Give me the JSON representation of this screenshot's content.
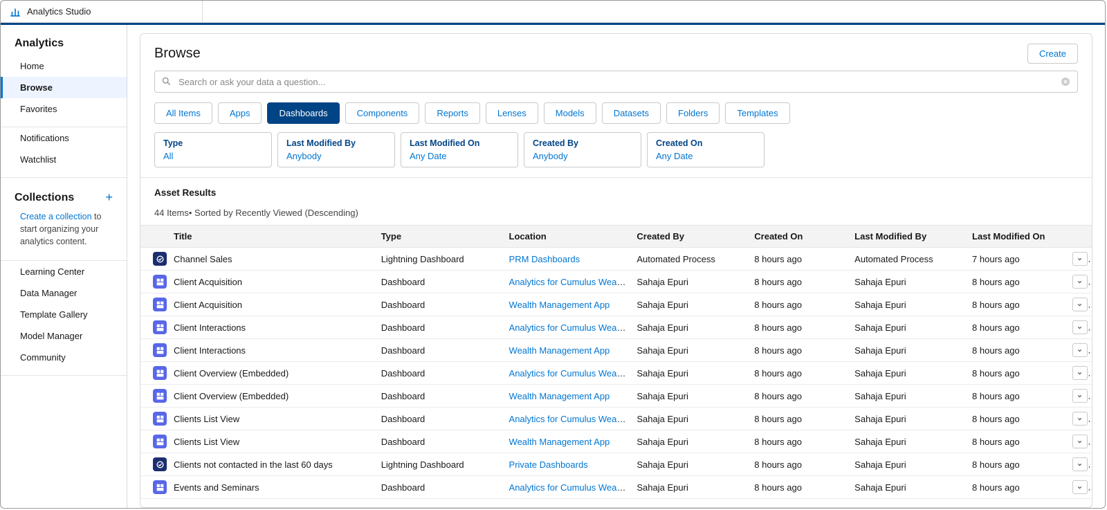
{
  "header": {
    "app_name": "Analytics Studio"
  },
  "sidebar": {
    "sections": [
      {
        "heading": "Analytics",
        "items": [
          "Home",
          "Browse",
          "Favorites"
        ],
        "active": "Browse"
      },
      {
        "items": [
          "Notifications",
          "Watchlist"
        ]
      },
      {
        "heading": "Collections",
        "plus": true,
        "desc_link": "Create a collection",
        "desc_rest": " to start organizing your analytics content."
      },
      {
        "items": [
          "Learning Center",
          "Data Manager",
          "Template Gallery",
          "Model Manager",
          "Community"
        ]
      }
    ]
  },
  "browse": {
    "title": "Browse",
    "create_label": "Create",
    "search_placeholder": "Search or ask your data a question...",
    "pills": [
      "All Items",
      "Apps",
      "Dashboards",
      "Components",
      "Reports",
      "Lenses",
      "Models",
      "Datasets",
      "Folders",
      "Templates"
    ],
    "active_pill": "Dashboards",
    "filters": [
      {
        "label": "Type",
        "value": "All"
      },
      {
        "label": "Last Modified By",
        "value": "Anybody"
      },
      {
        "label": "Last Modified On",
        "value": "Any Date"
      },
      {
        "label": "Created By",
        "value": "Anybody"
      },
      {
        "label": "Created On",
        "value": "Any Date"
      }
    ],
    "results_heading": "Asset Results",
    "results_sub": "44 Items• Sorted by Recently Viewed (Descending)",
    "columns": [
      "Title",
      "Type",
      "Location",
      "Created By",
      "Created On",
      "Last Modified By",
      "Last Modified On"
    ],
    "rows": [
      {
        "icon": "lt",
        "title": "Channel Sales",
        "type": "Lightning Dashboard",
        "location": "PRM Dashboards",
        "created_by": "Automated Process",
        "created_on": "8 hours ago",
        "last_mod_by": "Automated Process",
        "last_mod_on": "7 hours ago"
      },
      {
        "icon": "dash",
        "title": "Client Acquisition",
        "type": "Dashboard",
        "location": "Analytics for Cumulus Wealt...",
        "created_by": "Sahaja Epuri",
        "created_on": "8 hours ago",
        "last_mod_by": "Sahaja Epuri",
        "last_mod_on": "8 hours ago"
      },
      {
        "icon": "dash",
        "title": "Client Acquisition",
        "type": "Dashboard",
        "location": "Wealth Management App",
        "created_by": "Sahaja Epuri",
        "created_on": "8 hours ago",
        "last_mod_by": "Sahaja Epuri",
        "last_mod_on": "8 hours ago"
      },
      {
        "icon": "dash",
        "title": "Client Interactions",
        "type": "Dashboard",
        "location": "Analytics for Cumulus Wealt...",
        "created_by": "Sahaja Epuri",
        "created_on": "8 hours ago",
        "last_mod_by": "Sahaja Epuri",
        "last_mod_on": "8 hours ago"
      },
      {
        "icon": "dash",
        "title": "Client Interactions",
        "type": "Dashboard",
        "location": "Wealth Management App",
        "created_by": "Sahaja Epuri",
        "created_on": "8 hours ago",
        "last_mod_by": "Sahaja Epuri",
        "last_mod_on": "8 hours ago"
      },
      {
        "icon": "dash",
        "title": "Client Overview (Embedded)",
        "type": "Dashboard",
        "location": "Analytics for Cumulus Wealt...",
        "created_by": "Sahaja Epuri",
        "created_on": "8 hours ago",
        "last_mod_by": "Sahaja Epuri",
        "last_mod_on": "8 hours ago"
      },
      {
        "icon": "dash",
        "title": "Client Overview (Embedded)",
        "type": "Dashboard",
        "location": "Wealth Management App",
        "created_by": "Sahaja Epuri",
        "created_on": "8 hours ago",
        "last_mod_by": "Sahaja Epuri",
        "last_mod_on": "8 hours ago"
      },
      {
        "icon": "dash",
        "title": "Clients List View",
        "type": "Dashboard",
        "location": "Analytics for Cumulus Wealt...",
        "created_by": "Sahaja Epuri",
        "created_on": "8 hours ago",
        "last_mod_by": "Sahaja Epuri",
        "last_mod_on": "8 hours ago"
      },
      {
        "icon": "dash",
        "title": "Clients List View",
        "type": "Dashboard",
        "location": "Wealth Management App",
        "created_by": "Sahaja Epuri",
        "created_on": "8 hours ago",
        "last_mod_by": "Sahaja Epuri",
        "last_mod_on": "8 hours ago"
      },
      {
        "icon": "lt",
        "title": "Clients not contacted in the last 60 days",
        "type": "Lightning Dashboard",
        "location": "Private Dashboards",
        "created_by": "Sahaja Epuri",
        "created_on": "8 hours ago",
        "last_mod_by": "Sahaja Epuri",
        "last_mod_on": "8 hours ago"
      },
      {
        "icon": "dash",
        "title": "Events and Seminars",
        "type": "Dashboard",
        "location": "Analytics for Cumulus Wealt...",
        "created_by": "Sahaja Epuri",
        "created_on": "8 hours ago",
        "last_mod_by": "Sahaja Epuri",
        "last_mod_on": "8 hours ago"
      }
    ]
  }
}
